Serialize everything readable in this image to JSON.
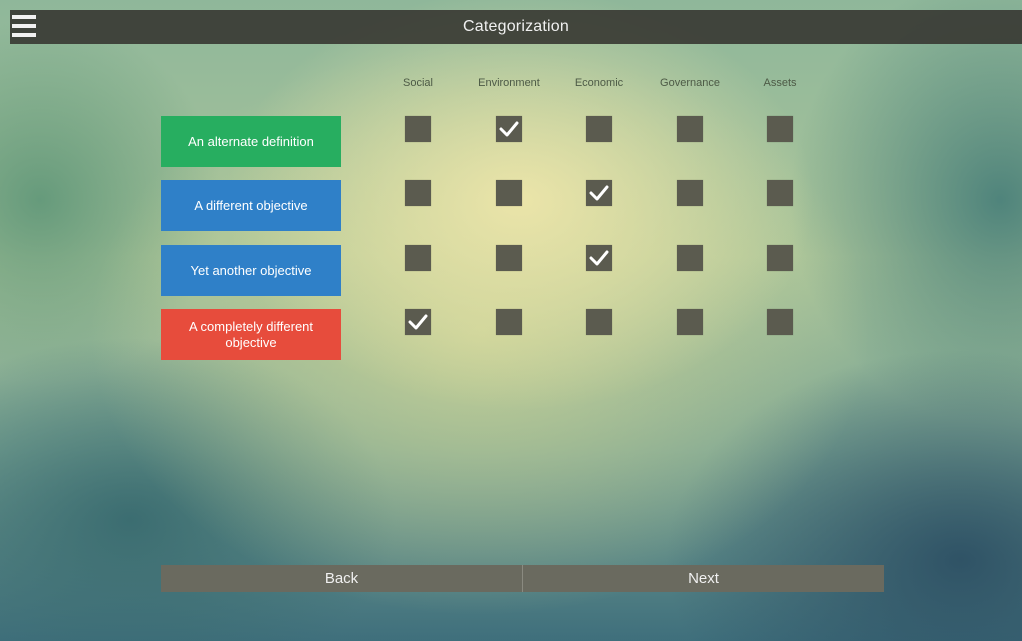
{
  "header": {
    "title": "Categorization",
    "menu_icon": "hamburger-menu-icon"
  },
  "columns": [
    "Social",
    "Environment",
    "Economic",
    "Governance",
    "Assets"
  ],
  "rows": [
    {
      "label": "An alternate definition",
      "color": "#27ae60",
      "checked": [
        false,
        true,
        false,
        false,
        false
      ]
    },
    {
      "label": "A different objective",
      "color": "#2f80c8",
      "checked": [
        false,
        false,
        true,
        false,
        false
      ]
    },
    {
      "label": "Yet another objective",
      "color": "#2f80c8",
      "checked": [
        false,
        false,
        true,
        false,
        false
      ]
    },
    {
      "label": "A completely different objective",
      "color": "#e74c3c",
      "checked": [
        true,
        false,
        false,
        false,
        false
      ]
    }
  ],
  "footer": {
    "back_label": "Back",
    "next_label": "Next"
  }
}
